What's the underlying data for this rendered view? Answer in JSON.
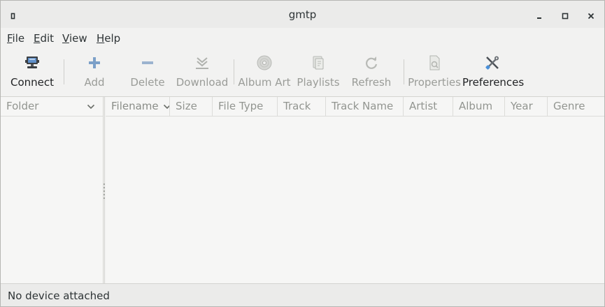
{
  "window": {
    "title": "gmtp"
  },
  "menu": [
    {
      "u": "F",
      "rest": "ile"
    },
    {
      "u": "E",
      "rest": "dit"
    },
    {
      "u": "V",
      "rest": "iew"
    },
    {
      "u": "H",
      "rest": "elp"
    }
  ],
  "toolbar": {
    "connect": "Connect",
    "add": "Add",
    "delete": "Delete",
    "download": "Download",
    "album_art": "Album Art",
    "playlists": "Playlists",
    "refresh": "Refresh",
    "properties": "Properties",
    "preferences": "Preferences"
  },
  "icons": {
    "connect": "computer-icon",
    "add": "plus-icon",
    "delete": "minus-icon",
    "download": "download-icon",
    "album_art": "cd-icon",
    "playlists": "playlist-icon",
    "refresh": "refresh-icon",
    "properties": "properties-icon",
    "preferences": "tools-icon"
  },
  "folder_pane": {
    "header": "Folder"
  },
  "file_list": {
    "columns": [
      "Filename",
      "Size",
      "File Type",
      "Track",
      "Track Name",
      "Artist",
      "Album",
      "Year",
      "Genre"
    ]
  },
  "status": {
    "text": "No device attached"
  },
  "colors": {
    "accent": "#4a90d9",
    "disabled": "#9a9c98"
  }
}
